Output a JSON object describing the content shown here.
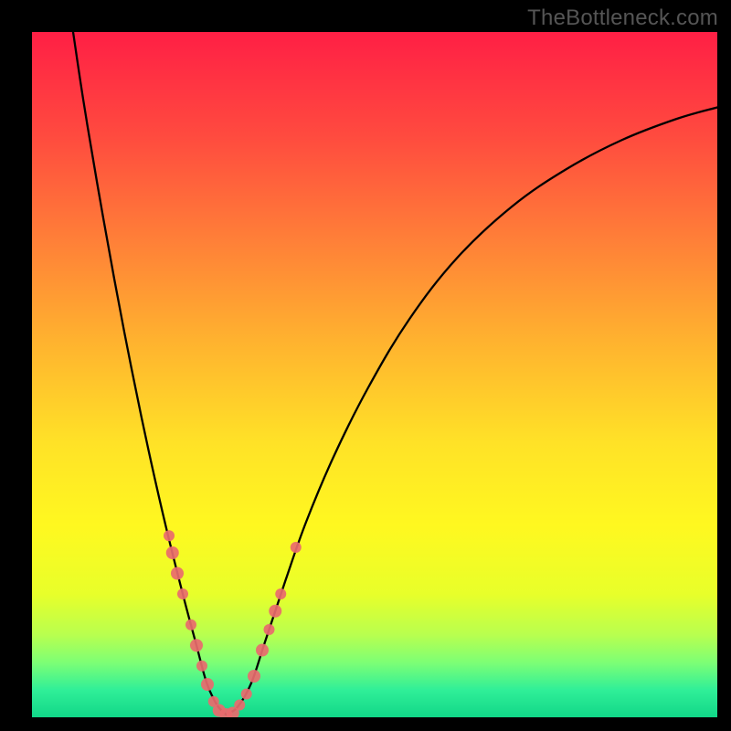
{
  "watermark": "TheBottleneck.com",
  "chart_data": {
    "type": "line",
    "title": "",
    "xlabel": "",
    "ylabel": "",
    "xlim": [
      0,
      100
    ],
    "ylim": [
      0,
      100
    ],
    "background_gradient_stops": [
      {
        "offset": 0.0,
        "color": "#ff1f45"
      },
      {
        "offset": 0.15,
        "color": "#ff4a3f"
      },
      {
        "offset": 0.3,
        "color": "#ff7e38"
      },
      {
        "offset": 0.45,
        "color": "#ffb22f"
      },
      {
        "offset": 0.6,
        "color": "#ffe227"
      },
      {
        "offset": 0.72,
        "color": "#fff820"
      },
      {
        "offset": 0.82,
        "color": "#e8ff2a"
      },
      {
        "offset": 0.88,
        "color": "#b8ff4f"
      },
      {
        "offset": 0.92,
        "color": "#7dff75"
      },
      {
        "offset": 0.96,
        "color": "#30ef98"
      },
      {
        "offset": 1.0,
        "color": "#11d788"
      }
    ],
    "series": [
      {
        "name": "left-branch",
        "type": "line",
        "points": [
          {
            "x": 6.0,
            "y": 100.0
          },
          {
            "x": 7.5,
            "y": 90.0
          },
          {
            "x": 9.5,
            "y": 78.0
          },
          {
            "x": 12.0,
            "y": 64.0
          },
          {
            "x": 14.5,
            "y": 51.0
          },
          {
            "x": 17.0,
            "y": 39.0
          },
          {
            "x": 19.5,
            "y": 28.0
          },
          {
            "x": 22.0,
            "y": 18.0
          },
          {
            "x": 24.0,
            "y": 10.5
          },
          {
            "x": 25.5,
            "y": 5.0
          },
          {
            "x": 27.0,
            "y": 1.8
          },
          {
            "x": 28.3,
            "y": 0.4
          }
        ]
      },
      {
        "name": "right-branch",
        "type": "line",
        "points": [
          {
            "x": 28.3,
            "y": 0.4
          },
          {
            "x": 30.0,
            "y": 1.5
          },
          {
            "x": 32.0,
            "y": 5.0
          },
          {
            "x": 34.0,
            "y": 11.0
          },
          {
            "x": 37.0,
            "y": 20.0
          },
          {
            "x": 40.0,
            "y": 28.5
          },
          {
            "x": 44.0,
            "y": 38.0
          },
          {
            "x": 49.0,
            "y": 48.0
          },
          {
            "x": 55.0,
            "y": 58.0
          },
          {
            "x": 62.0,
            "y": 67.0
          },
          {
            "x": 70.0,
            "y": 74.5
          },
          {
            "x": 78.0,
            "y": 80.0
          },
          {
            "x": 86.0,
            "y": 84.2
          },
          {
            "x": 94.0,
            "y": 87.3
          },
          {
            "x": 100.0,
            "y": 89.0
          }
        ]
      },
      {
        "name": "data-markers",
        "type": "scatter",
        "color": "#e96a6e",
        "points": [
          {
            "x": 20.0,
            "y": 26.5,
            "r": 6
          },
          {
            "x": 20.5,
            "y": 24.0,
            "r": 7
          },
          {
            "x": 21.2,
            "y": 21.0,
            "r": 7
          },
          {
            "x": 22.0,
            "y": 18.0,
            "r": 6
          },
          {
            "x": 23.2,
            "y": 13.5,
            "r": 6
          },
          {
            "x": 24.0,
            "y": 10.5,
            "r": 7
          },
          {
            "x": 24.8,
            "y": 7.5,
            "r": 6
          },
          {
            "x": 25.6,
            "y": 4.8,
            "r": 7
          },
          {
            "x": 26.5,
            "y": 2.3,
            "r": 6
          },
          {
            "x": 27.3,
            "y": 1.0,
            "r": 7
          },
          {
            "x": 28.3,
            "y": 0.4,
            "r": 7
          },
          {
            "x": 29.3,
            "y": 0.6,
            "r": 7
          },
          {
            "x": 30.3,
            "y": 1.8,
            "r": 6
          },
          {
            "x": 31.3,
            "y": 3.4,
            "r": 6
          },
          {
            "x": 32.4,
            "y": 6.0,
            "r": 7
          },
          {
            "x": 33.6,
            "y": 9.8,
            "r": 7
          },
          {
            "x": 34.6,
            "y": 12.8,
            "r": 6
          },
          {
            "x": 35.5,
            "y": 15.5,
            "r": 7
          },
          {
            "x": 36.3,
            "y": 18.0,
            "r": 6
          },
          {
            "x": 38.5,
            "y": 24.8,
            "r": 6
          }
        ]
      }
    ]
  }
}
